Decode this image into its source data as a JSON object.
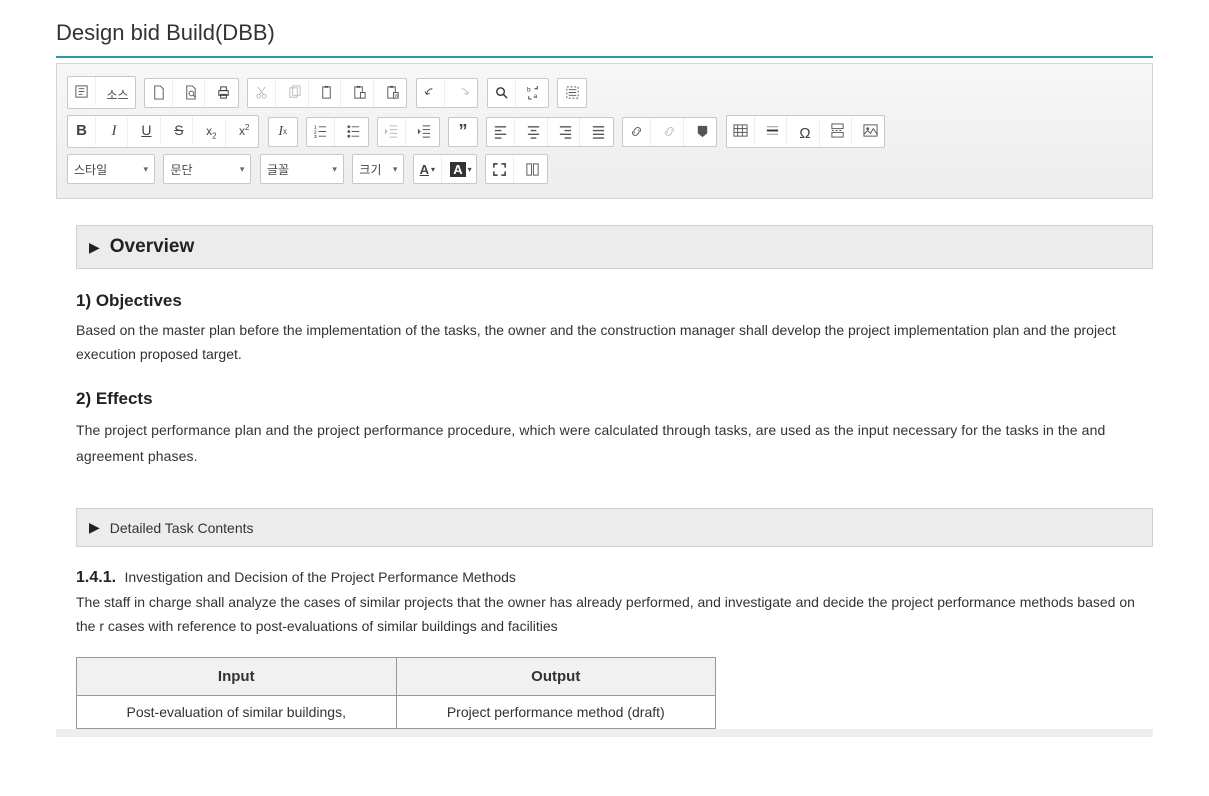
{
  "page": {
    "title": "Design bid Build(DBB)"
  },
  "toolbar": {
    "source_label": "소스",
    "select_style": "스타일",
    "select_paragraph": "문단",
    "select_font": "글꼴",
    "select_size": "크기",
    "font_color_label": "A",
    "bg_color_label": "A"
  },
  "content": {
    "overview_heading": "Overview",
    "objectives_heading": "1) Objectives",
    "objectives_body": "Based on the master plan before the implementation of the tasks, the owner and the construction manager shall develop the project implementation plan and the project execution proposed target.",
    "effects_heading": "2) Effects",
    "effects_body": "The project performance plan and the project performance procedure, which were calculated through tasks, are used as the input necessary for the tasks in the and agreement phases.",
    "detailed_heading": "Detailed Task Contents",
    "sec_number": "1.4.1.",
    "sec_title": "Investigation and Decision of the Project Performance Methods",
    "sec_body": "The staff in charge shall analyze the cases of similar projects that the owner has already performed, and investigate and decide the project performance methods based on the r cases with reference to post-evaluations of similar buildings and facilities",
    "table": {
      "head_input": "Input",
      "head_output": "Output",
      "cell_input": "Post-evaluation of similar buildings,",
      "cell_output": "Project performance method (draft)"
    }
  }
}
